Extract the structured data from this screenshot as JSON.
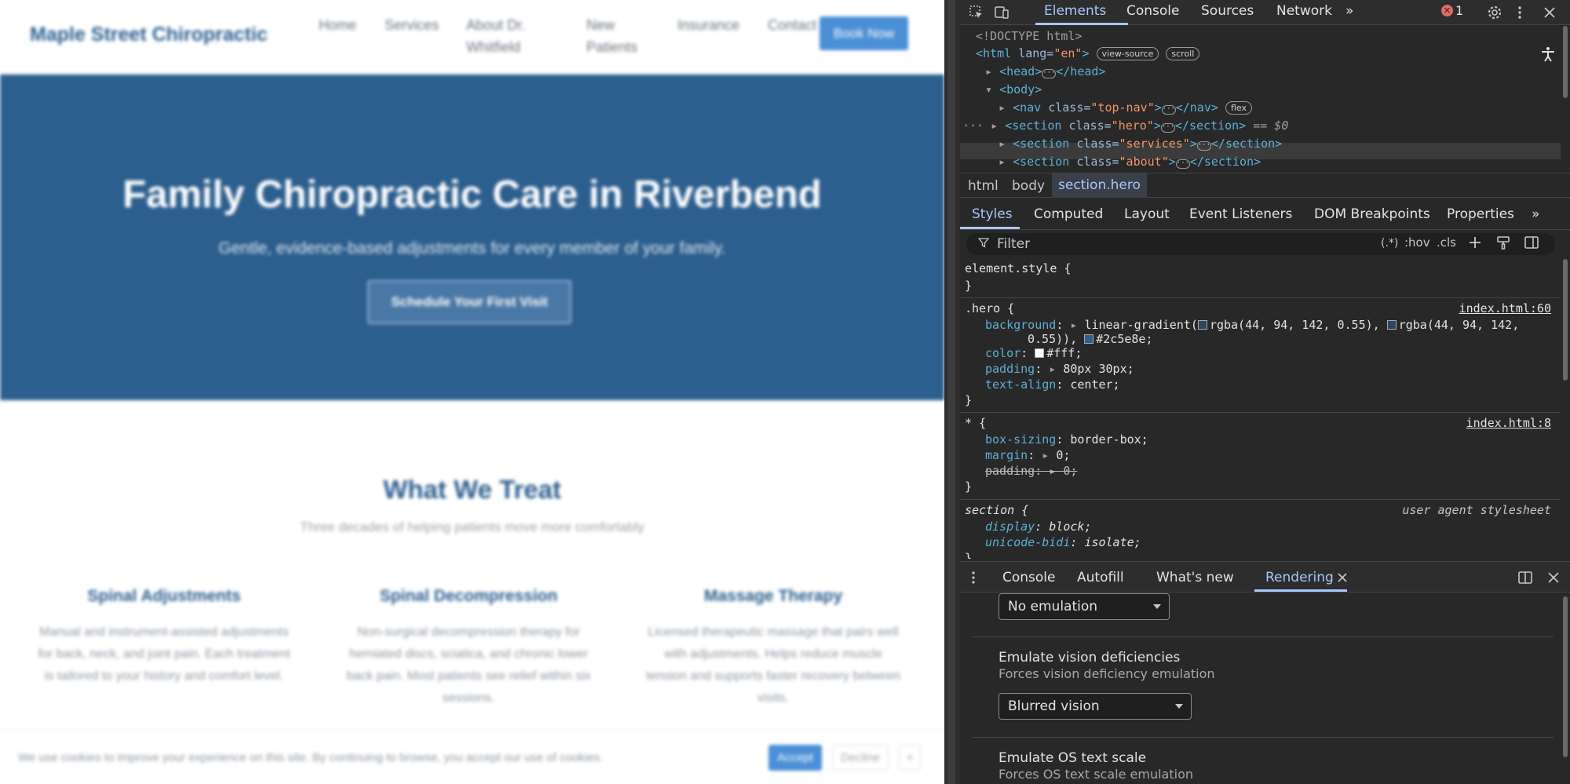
{
  "site": {
    "brand": "Maple Street Chiropractic",
    "nav": [
      "Home",
      "Services",
      "About Dr.\nWhitfield",
      "New\nPatients",
      "Insurance",
      "Contact"
    ],
    "book_now": "Book Now",
    "hero": {
      "title": "Family Chiropractic Care in Riverbend",
      "subtitle": "Gentle, evidence-based adjustments for every member of your family.",
      "cta": "Schedule Your First Visit"
    },
    "services": {
      "title": "What We Treat",
      "subtitle": "Three decades of helping patients move more comfortably",
      "cards": [
        {
          "title": "Spinal Adjustments",
          "text": "Manual and instrument-assisted adjustments for back, neck, and joint pain. Each treatment is tailored to your history and comfort level."
        },
        {
          "title": "Spinal Decompression",
          "text": "Non-surgical decompression therapy for herniated discs, sciatica, and chronic lower back pain. Most patients see relief within six sessions."
        },
        {
          "title": "Massage Therapy",
          "text": "Licensed therapeutic massage that pairs well with adjustments. Helps reduce muscle tension and supports faster recovery between visits."
        }
      ]
    },
    "cookie": {
      "text": "We use cookies to improve your experience on this site. By continuing to browse, you accept our use of cookies.",
      "accept": "Accept",
      "decline": "Decline",
      "close": "×"
    }
  },
  "devtools": {
    "tabs": [
      "Elements",
      "Console",
      "Sources",
      "Network"
    ],
    "more_tabs": "»",
    "error_count": "1",
    "dom": {
      "doctype": "<!DOCTYPE html>",
      "html_tag": "<html ",
      "html_attr": "lang=",
      "html_val": "\"en\"",
      "html_close": ">",
      "pill_view_source": "view-source",
      "pill_scroll": "scroll",
      "head_open": "<head>",
      "head_close": "</head>",
      "body_open": "<body>",
      "nodes": [
        {
          "tag": "nav",
          "cls": "\"top-nav\"",
          "badge": "flex"
        },
        {
          "tag": "section",
          "cls": "\"hero\"",
          "badge": "== $0"
        },
        {
          "tag": "section",
          "cls": "\"services\"",
          "badge": ""
        },
        {
          "tag": "section",
          "cls": "\"about\"",
          "badge": ""
        }
      ]
    },
    "breadcrumbs": [
      "html",
      "body",
      "section.hero"
    ],
    "subtabs": [
      "Styles",
      "Computed",
      "Layout",
      "Event Listeners",
      "DOM Breakpoints",
      "Properties"
    ],
    "filter": {
      "placeholder": "Filter",
      "regex": "(.*)",
      "hov": ":hov",
      "cls": ".cls"
    },
    "styles": {
      "element_style": "element.style {",
      "close_brace": "}",
      "hero_selector": ".hero {",
      "hero_source": "index.html:60",
      "hero_props": {
        "background_name": "background",
        "background_value_1": "linear-gradient(",
        "rgba_1": "rgba(44, 94, 142, 0.55),",
        "rgba_2": "rgba(44, 94, 142,",
        "background_value_2": "0.55)),",
        "hex": "#2c5e8e;",
        "color_name": "color",
        "color_value": "#fff;",
        "padding_name": "padding",
        "padding_value": "80px 30px;",
        "text_align_name": "text-align",
        "text_align_value": "center;"
      },
      "star_selector": "* {",
      "star_source": "index.html:8",
      "star_props": {
        "box_sizing_name": "box-sizing",
        "box_sizing_value": "border-box;",
        "margin_name": "margin",
        "margin_value": "0;",
        "padding_name": "padding",
        "padding_value": "0;"
      },
      "section_selector": "section {",
      "section_source": "user agent stylesheet",
      "section_props": {
        "display_name": "display",
        "display_value": "block;",
        "unicode_name": "unicode-bidi",
        "unicode_value": "isolate;"
      }
    },
    "drawer_tabs": [
      "Console",
      "Autofill",
      "What's new",
      "Rendering"
    ],
    "rendering": {
      "media_select": "No emulation",
      "vision_title": "Emulate vision deficiencies",
      "vision_desc": "Forces vision deficiency emulation",
      "vision_select": "Blurred vision",
      "os_title": "Emulate OS text scale",
      "os_desc": "Forces OS text scale emulation"
    },
    "colors": {
      "accent": "#a8c7fa",
      "hero_bg": "#2c5e8e",
      "error": "#e46962"
    }
  }
}
